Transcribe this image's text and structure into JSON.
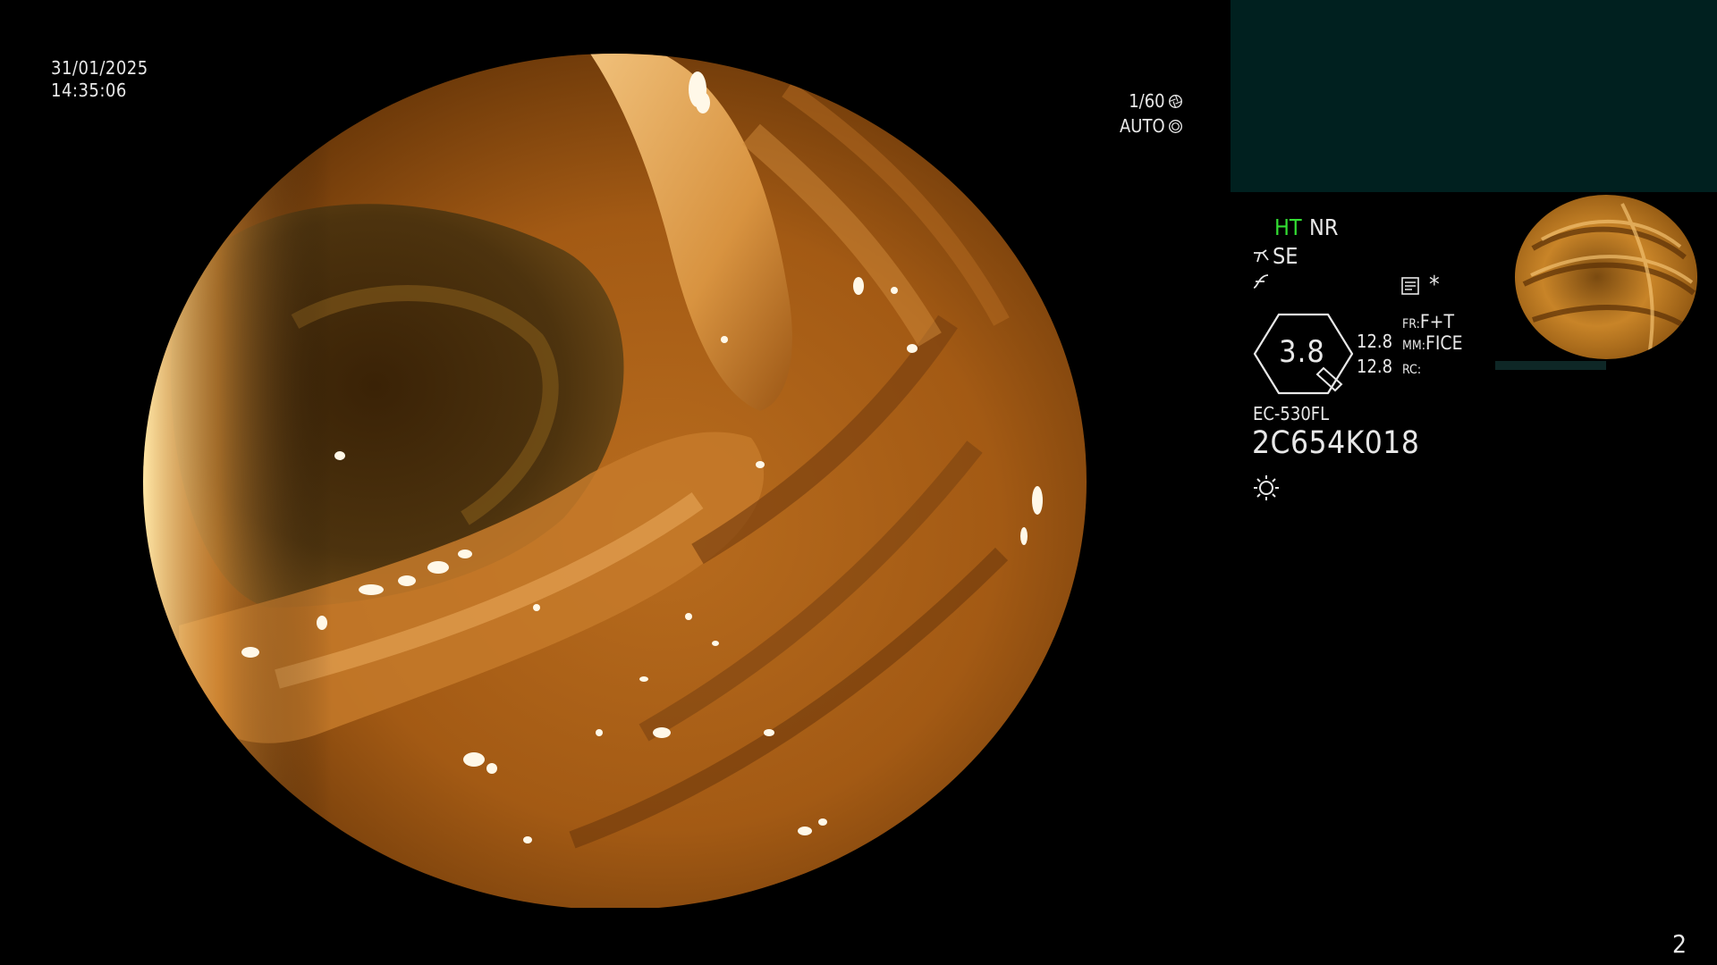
{
  "datetime": {
    "date": "31/01/2025",
    "time": "14:35:06"
  },
  "exposure": {
    "shutter": "1/60",
    "iris": "AUTO"
  },
  "status": {
    "ht": "HT",
    "nr": "NR",
    "se": "SE",
    "asterisk": "*"
  },
  "gauge": {
    "value": "3.8"
  },
  "readouts": {
    "a": "12.8",
    "b": "12.8"
  },
  "settings": [
    {
      "key": "FR:",
      "value": "F+T"
    },
    {
      "key": "MM:",
      "value": "FICE"
    },
    {
      "key": "RC:",
      "value": ""
    }
  ],
  "scope": {
    "model": "EC-530FL",
    "serial": "2C654K018"
  },
  "page_number": "2",
  "colors": {
    "ht_green": "#33dd33",
    "panel_teal": "#00201f",
    "text": "#e8e8e8"
  },
  "icons": [
    "shutter-ring-icon",
    "iris-ring-icon",
    "se-hand-icon",
    "curve-icon",
    "memo-icon",
    "gauge-icon",
    "sun-icon"
  ]
}
